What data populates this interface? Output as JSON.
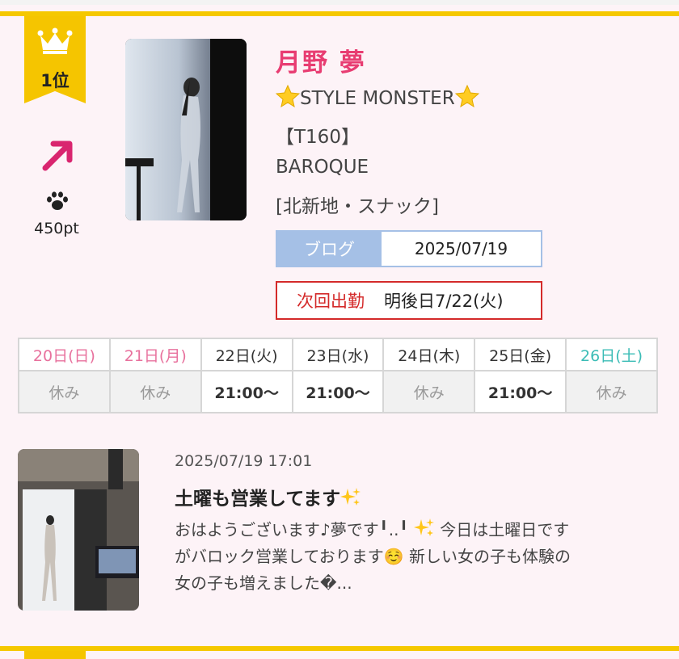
{
  "ranking": {
    "rank_label": "1位",
    "trend": "up-arrow",
    "points_icon": "paw-icon",
    "points": "450pt"
  },
  "profile": {
    "name": "月野 夢",
    "tagline": "STYLE MONSTER",
    "height": "【T160】",
    "shop": "BAROQUE",
    "area": "[北新地・スナック]"
  },
  "blog": {
    "label": "ブログ",
    "date": "2025/07/19"
  },
  "next_work": {
    "label": "次回出勤",
    "value": "明後日7/22(火)"
  },
  "schedule": {
    "days": [
      "20日(日)",
      "21日(月)",
      "22日(火)",
      "23日(水)",
      "24日(木)",
      "25日(金)",
      "26日(土)"
    ],
    "day_colors": [
      "#e8719d",
      "#e8719d",
      "#333333",
      "#333333",
      "#333333",
      "#333333",
      "#3bbcb6"
    ],
    "times": [
      "休み",
      "休み",
      "21:00〜",
      "21:00〜",
      "休み",
      "21:00〜",
      "休み"
    ],
    "working": [
      false,
      false,
      true,
      true,
      false,
      true,
      false
    ]
  },
  "post": {
    "datetime": "2025/07/19 17:01",
    "title": "土曜も営業してます",
    "body_line1": "おはようございます♪夢です╹..╹",
    "body_line1b": " 今日は土曜日です",
    "body_line2": "がバロック営業しております☺️ 新しい女の子も体験の",
    "body_line3": "女の子も増えました�..."
  },
  "colors": {
    "accent_pink": "#e83d72",
    "gold": "#f5c500",
    "blog_blue": "#a5c0e6",
    "alert_red": "#d42a2a"
  }
}
